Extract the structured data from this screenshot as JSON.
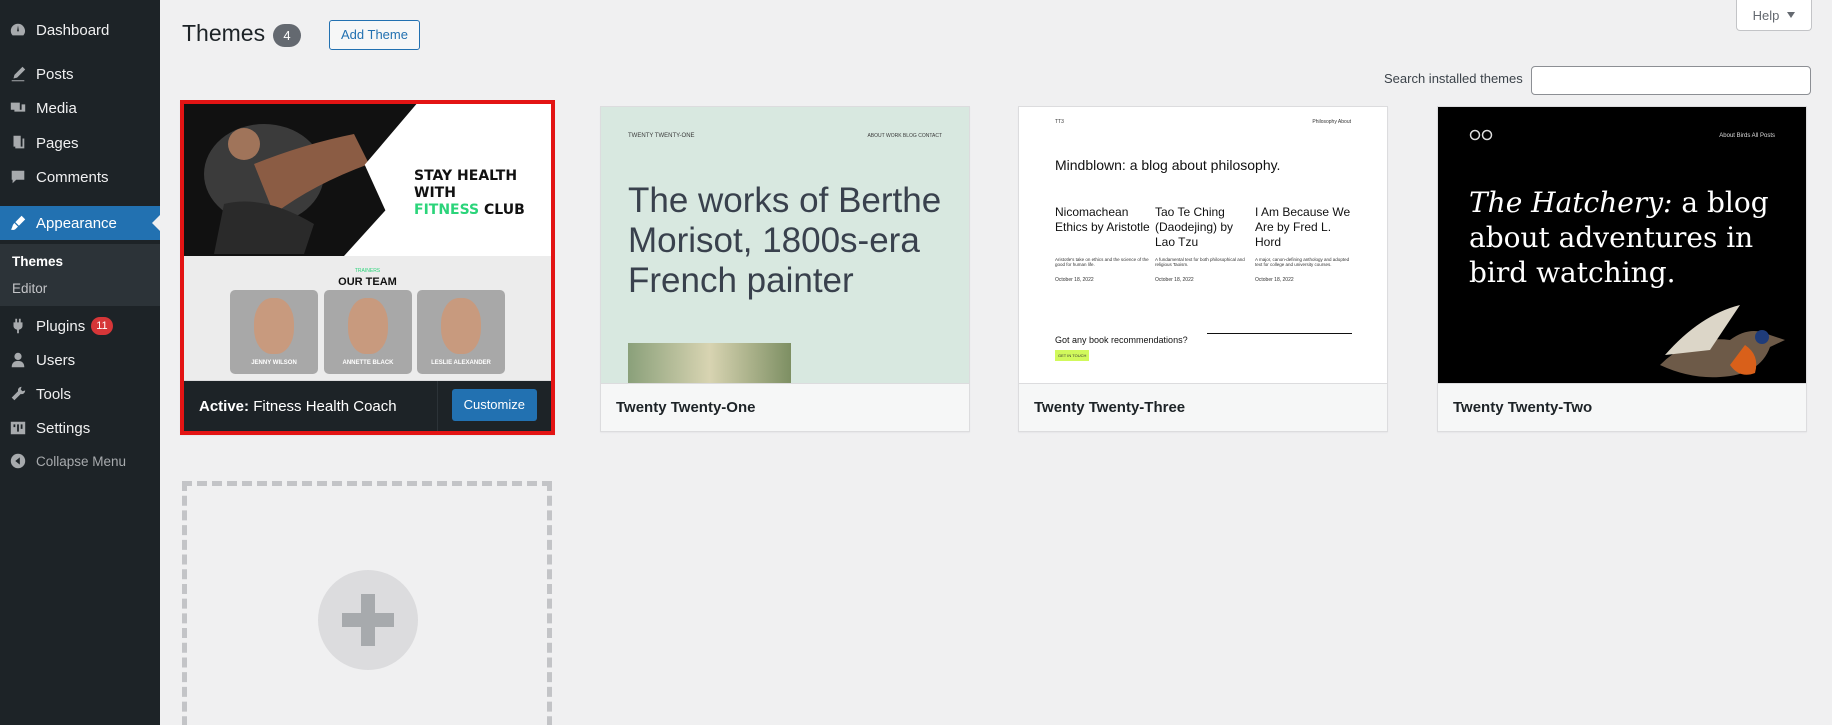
{
  "sidebar": {
    "items": [
      {
        "label": "Dashboard",
        "icon": "dashboard-icon"
      },
      {
        "label": "Posts",
        "icon": "posts-icon"
      },
      {
        "label": "Media",
        "icon": "media-icon"
      },
      {
        "label": "Pages",
        "icon": "pages-icon"
      },
      {
        "label": "Comments",
        "icon": "comments-icon"
      },
      {
        "label": "Appearance",
        "icon": "appearance-icon"
      },
      {
        "label": "Plugins",
        "icon": "plugins-icon",
        "badge": "11"
      },
      {
        "label": "Users",
        "icon": "users-icon"
      },
      {
        "label": "Tools",
        "icon": "tools-icon"
      },
      {
        "label": "Settings",
        "icon": "settings-icon"
      }
    ],
    "submenu": [
      {
        "label": "Themes"
      },
      {
        "label": "Editor"
      }
    ],
    "collapse_label": "Collapse Menu"
  },
  "header": {
    "title": "Themes",
    "count": "4",
    "add_theme_label": "Add Theme",
    "help_label": "Help",
    "search_label": "Search installed themes",
    "search_value": ""
  },
  "themes": {
    "active": {
      "prefix": "Active:",
      "name": "Fitness Health Coach",
      "customize_label": "Customize",
      "preview": {
        "headline_1": "STAY HEALTH WITH",
        "headline_green": "FITNESS",
        "headline_2": "CLUB",
        "section_small": "TRAINERS",
        "section_title": "OUR TEAM",
        "trainers": [
          "JENNY WILSON",
          "ANNETTE BLACK",
          "LESLIE ALEXANDER"
        ]
      }
    },
    "twenty_one": {
      "name": "Twenty Twenty-One",
      "preview": {
        "site_title": "TWENTY TWENTY-ONE",
        "nav": "ABOUT   WORK   BLOG   CONTACT",
        "headline": "The works of Berthe Morisot, 1800s-era French painter"
      }
    },
    "twenty_three": {
      "name": "Twenty Twenty-Three",
      "preview": {
        "site_title": "TT3",
        "nav": "Philosophy   About",
        "headline": "Mindblown: a blog about philosophy.",
        "posts": [
          {
            "title": "Nicomachean Ethics by Aristotle",
            "desc": "Aristotle's take on ethics and the science of the good for human life.",
            "date": "October 18, 2022"
          },
          {
            "title": "Tao Te Ching (Daodejing) by Lao Tzu",
            "desc": "A fundamental text for both philosophical and religious Taoism.",
            "date": "October 18, 2022"
          },
          {
            "title": "I Am Because We Are by Fred L. Hord",
            "desc": "A major, canon-defining anthology and adopted text for college and university courses.",
            "date": "October 18, 2022"
          }
        ],
        "question": "Got any book recommendations?",
        "button": "GET IN TOUCH"
      }
    },
    "twenty_two": {
      "name": "Twenty Twenty-Two",
      "preview": {
        "nav": "About   Birds   All Posts",
        "headline_italic": "The Hatchery:",
        "headline_rest": " a blog about adventures in bird watching."
      }
    }
  },
  "colors": {
    "sidebar_bg": "#1d2327",
    "accent": "#2271b1",
    "active_outline": "#e31414",
    "badge": "#d63638"
  }
}
